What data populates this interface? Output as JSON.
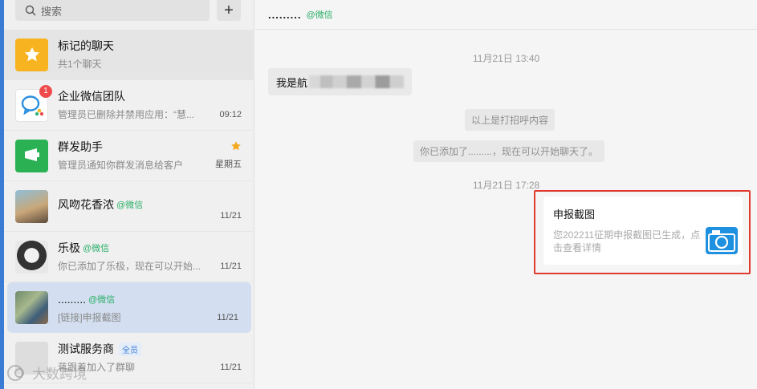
{
  "search": {
    "placeholder": "搜索"
  },
  "chats": [
    {
      "title": "标记的聊天",
      "preview": "共1个聊天"
    },
    {
      "title": "企业微信团队",
      "preview": "管理员已删除并禁用应用：“慧...",
      "time": "09:12",
      "badge": "1"
    },
    {
      "title": "群发助手",
      "preview": "管理员通知你群发消息给客户",
      "time": "星期五"
    },
    {
      "title": "风吻花香浓",
      "suffix": "@微信",
      "preview": "",
      "time": "11/21"
    },
    {
      "title": "乐极",
      "suffix": "@微信",
      "preview": "你已添加了乐极，现在可以开始...",
      "time": "11/21"
    },
    {
      "title": ".........",
      "suffix": "@微信",
      "preview": "[链接]申报截图",
      "time": "11/21"
    },
    {
      "title": "测试服务商",
      "tag": "全员",
      "preview": "蒋跟着加入了群聊",
      "time": "11/21"
    }
  ],
  "conversation": {
    "name": ".........",
    "suffix": "@微信",
    "time1": "11月21日 13:40",
    "message1": "我是航",
    "system1": "以上是打招呼内容",
    "system2": "你已添加了.........，现在可以开始聊天了。",
    "time2": "11月21日 17:28",
    "card": {
      "title": "申报截图",
      "desc": "您202211征期申报截图已生成，点击查看详情",
      "icon": "camera-icon"
    }
  },
  "watermark": "大数跨境",
  "colors": {
    "accent": "#3a7bd5",
    "wechat_green": "#2aae67",
    "highlight": "#e13a2f",
    "camera": "#1e90e0"
  }
}
